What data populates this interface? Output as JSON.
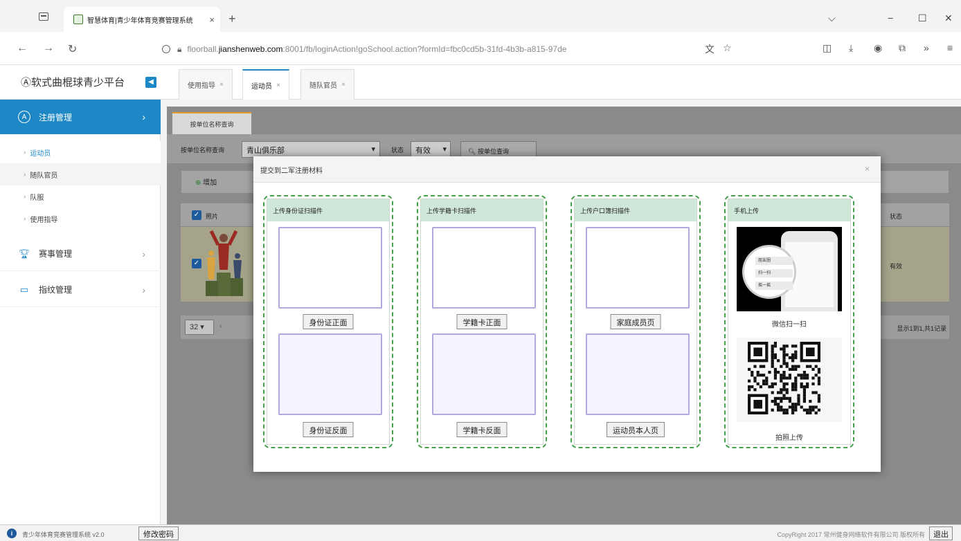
{
  "browser": {
    "tab_title": "智慧体育|青少年体育竞赛管理系统",
    "tab_close": "×",
    "new_tab": "+",
    "url_prefix": "floorball.",
    "url_domain": "jianshenweb.com",
    "url_rest": ":8001/fb/loginAction!goSchool.action?formId=fbc0cd5b-31fd-4b3b-a815-97de"
  },
  "app": {
    "logo": "Ⓐ软式曲棍球青少平台",
    "collapse_glyph": "◀"
  },
  "page_tabs": [
    {
      "label": "使用指导",
      "close": "×"
    },
    {
      "label": "运动员",
      "close": "×"
    },
    {
      "label": "随队官员",
      "close": "×"
    }
  ],
  "sidebar": {
    "menu_register": "注册管理",
    "sub_items": [
      "运动员",
      "随队官员",
      "队服",
      "使用指导"
    ],
    "menu_event": "赛事管理",
    "menu_guide": "指纹管理"
  },
  "query": {
    "tab_label": "按单位名称查询",
    "name_label": "按单位名称查询",
    "name_value": "青山俱乐部",
    "status_label": "状态",
    "status_value": "有效",
    "search_btn": "按单位查询"
  },
  "toolbar": {
    "add_label": "增加"
  },
  "grid": {
    "col_photo": "照片",
    "col_status": "状态",
    "row_status": "有效"
  },
  "pager": {
    "page_size": "32",
    "info": "显示1到1,共1记录"
  },
  "modal": {
    "title": "提交到二军注册材料",
    "close": "×",
    "cards": [
      {
        "title": "上传身份证扫描件",
        "btn_top": "身份证正面",
        "btn_bottom": "身份证反面"
      },
      {
        "title": "上传学籍卡扫描件",
        "btn_top": "学籍卡正面",
        "btn_bottom": "学籍卡反面"
      },
      {
        "title": "上传户口簿扫描件",
        "btn_top": "家庭成员页",
        "btn_bottom": "运动员本人页"
      }
    ],
    "mobile": {
      "title": "手机上传",
      "wechat_label": "微信扫一扫",
      "qr_label": "拍照上传",
      "zoom_items": [
        "朋友圈",
        "扫一扫",
        "摇一摇"
      ]
    }
  },
  "status": {
    "info_glyph": "i",
    "text": "青少年体育竞赛管理系统 v2.0",
    "change_pwd": "修改密码",
    "copyright": "CopyRight 2017 常州健身网络软件有限公司 版权所有",
    "logout": "退出"
  },
  "colors": {
    "accent": "#1e88c7",
    "card_border": "#44a04a",
    "card_head": "#cfe7d9",
    "slot_border": "#b3a7e0"
  }
}
